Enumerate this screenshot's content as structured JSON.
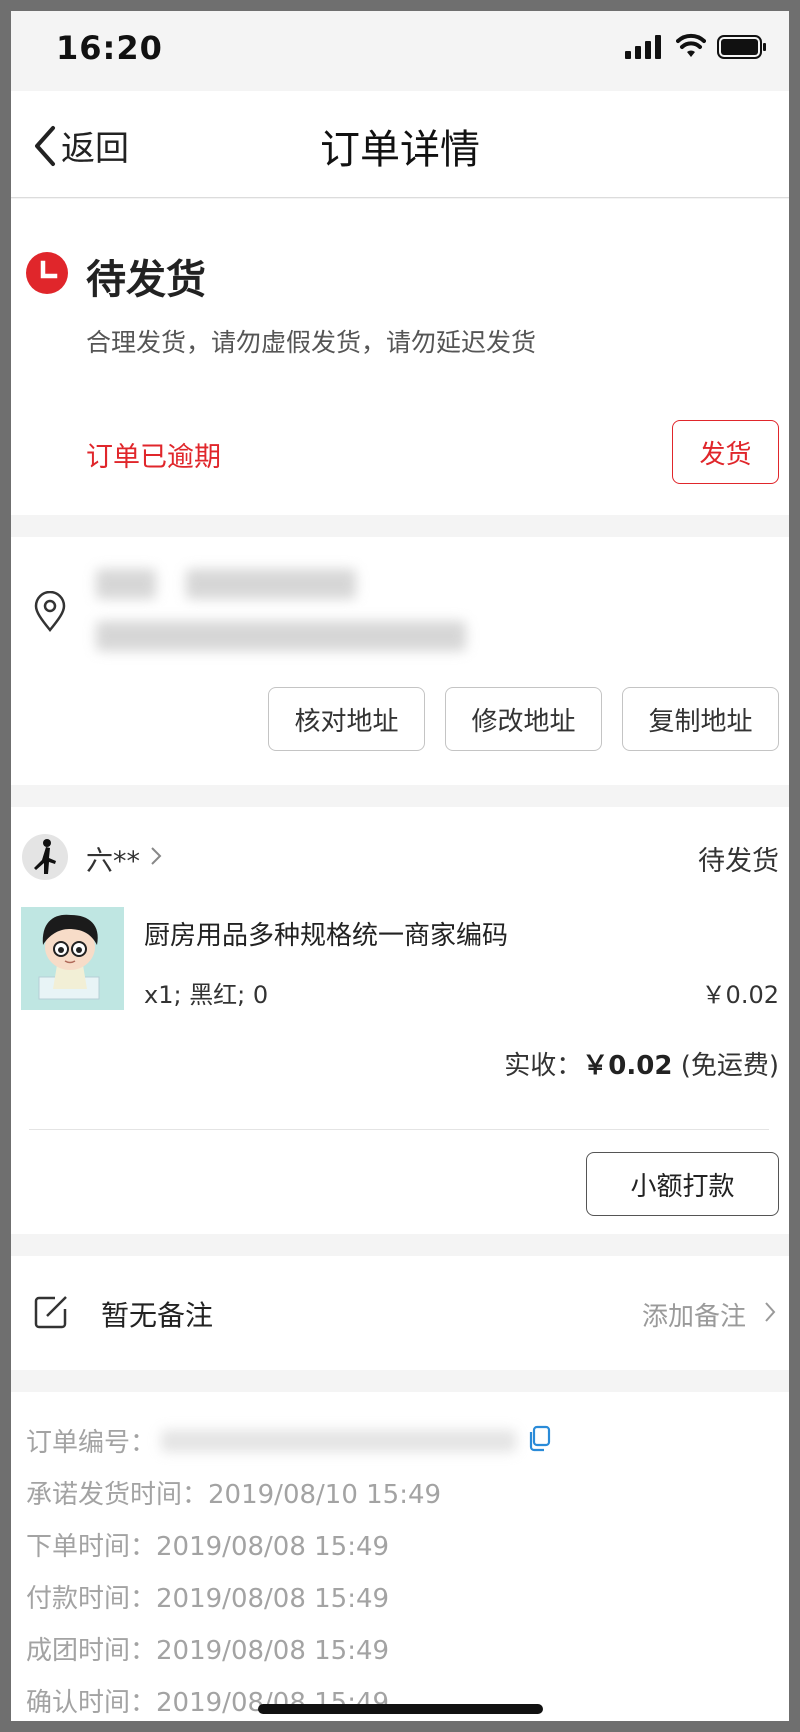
{
  "status_bar": {
    "time": "16:20"
  },
  "nav": {
    "back_label": "返回",
    "title": "订单详情"
  },
  "status_card": {
    "title": "待发货",
    "description": "合理发货，请勿虚假发货，请勿延迟发货",
    "overdue_text": "订单已逾期",
    "ship_button": "发货",
    "accent_color": "#e0262b"
  },
  "address": {
    "buttons": [
      "核对地址",
      "修改地址",
      "复制地址"
    ]
  },
  "order": {
    "buyer_name": "六**",
    "status": "待发货",
    "product_name": "厨房用品多种规格统一商家编码",
    "spec": "x1; 黑红; 0",
    "price": "￥0.02",
    "received_label": "实收：",
    "received_amount": "￥0.02",
    "received_note": "(免运费)",
    "pay_button": "小额打款"
  },
  "note": {
    "text": "暂无备注",
    "add_label": "添加备注"
  },
  "info": {
    "order_no_label": "订单编号：",
    "rows": [
      {
        "label": "承诺发货时间：",
        "value": "2019/08/10 15:49"
      },
      {
        "label": "下单时间：",
        "value": "2019/08/08 15:49"
      },
      {
        "label": "付款时间：",
        "value": "2019/08/08 15:49"
      },
      {
        "label": "成团时间：",
        "value": "2019/08/08 15:49"
      },
      {
        "label": "确认时间：",
        "value": "2019/08/08 15:49"
      }
    ]
  }
}
